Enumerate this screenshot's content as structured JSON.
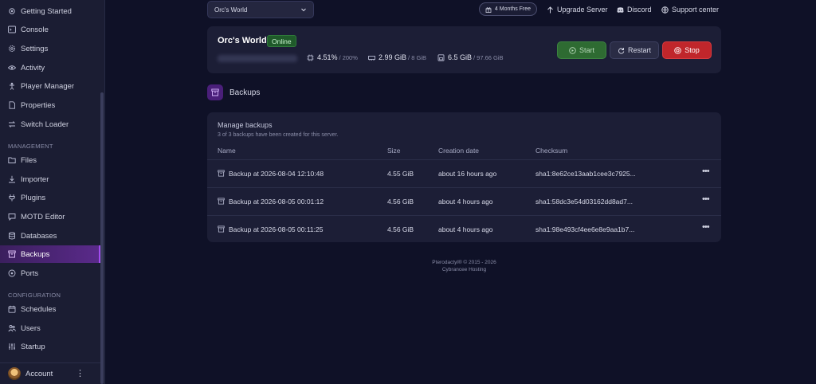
{
  "sidebar": {
    "items_top": [
      {
        "label": "Getting Started",
        "icon": "gear-icon"
      },
      {
        "label": "Console",
        "icon": "terminal-icon"
      },
      {
        "label": "Settings",
        "icon": "settings-icon"
      },
      {
        "label": "Activity",
        "icon": "eye-icon"
      },
      {
        "label": "Player Manager",
        "icon": "person-icon"
      },
      {
        "label": "Properties",
        "icon": "file-icon"
      },
      {
        "label": "Switch Loader",
        "icon": "switch-icon"
      }
    ],
    "management_label": "MANAGEMENT",
    "items_management": [
      {
        "label": "Files",
        "icon": "folder-icon"
      },
      {
        "label": "Importer",
        "icon": "download-icon"
      },
      {
        "label": "Plugins",
        "icon": "plug-icon"
      },
      {
        "label": "MOTD Editor",
        "icon": "message-icon"
      },
      {
        "label": "Databases",
        "icon": "database-icon"
      },
      {
        "label": "Backups",
        "icon": "archive-icon"
      },
      {
        "label": "Ports",
        "icon": "network-icon"
      }
    ],
    "configuration_label": "CONFIGURATION",
    "items_configuration": [
      {
        "label": "Schedules",
        "icon": "calendar-icon"
      },
      {
        "label": "Users",
        "icon": "users-icon"
      },
      {
        "label": "Startup",
        "icon": "sliders-icon"
      }
    ],
    "account_label": "Account"
  },
  "topbar": {
    "server_select": "Orc's World",
    "promo": "4 Months Free",
    "upgrade": "Upgrade Server",
    "discord": "Discord",
    "support": "Support center"
  },
  "server": {
    "name": "Orc's World",
    "status": "Online",
    "cpu": "4.51%",
    "cpu_limit": "/ 200%",
    "memory": "2.99 GiB",
    "memory_limit": "/ 8 GiB",
    "disk": "6.5 GiB",
    "disk_limit": "/ 97.66 GiB",
    "start_label": "Start",
    "restart_label": "Restart",
    "stop_label": "Stop"
  },
  "backups": {
    "title": "Backups",
    "manage_title": "Manage backups",
    "subtitle": "3 of 3 backups have been created for this server.",
    "columns": [
      "Name",
      "Size",
      "Creation date",
      "Checksum"
    ],
    "rows": [
      {
        "name": "Backup at 2026-08-04 12:10:48",
        "size": "4.55 GiB",
        "created": "about 16 hours ago",
        "checksum": "sha1:8e62ce13aab1cee3c7925..."
      },
      {
        "name": "Backup at 2026-08-05 00:01:12",
        "size": "4.56 GiB",
        "created": "about 4 hours ago",
        "checksum": "sha1:58dc3e54d03162dd8ad7..."
      },
      {
        "name": "Backup at 2026-08-05 00:11:25",
        "size": "4.56 GiB",
        "created": "about 4 hours ago",
        "checksum": "sha1:98e493cf4ee6e8e9aa1b7..."
      }
    ]
  },
  "footer": {
    "line1": "Pterodactyl® © 2015 - 2026",
    "line2": "Cybrancee Hosting"
  }
}
